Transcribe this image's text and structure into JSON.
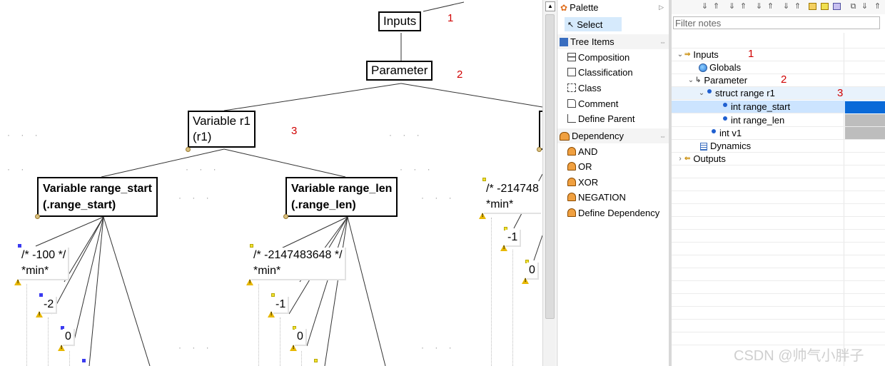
{
  "canvas": {
    "nodes": {
      "inputs": "Inputs",
      "parameter": "Parameter",
      "variable_r1_line1": "Variable r1",
      "variable_r1_line2": "(r1)",
      "range_start_line1": "Variable range_start",
      "range_start_line2": "(.range_start)",
      "range_len_line1": "Variable range_len",
      "range_len_line2": "(.range_len)"
    },
    "annotations": {
      "n1": "1",
      "n2": "2",
      "n3": "3"
    },
    "values": {
      "start_min_line1": "/* -100 */",
      "start_min_line2": "*min*",
      "start_v1": "-2",
      "start_v2": "0",
      "len_min_line1": "/* -2147483648 */",
      "len_min_line2": "*min*",
      "len_v1": "-1",
      "len_v2": "0",
      "v1_min_line1": "/* -214748",
      "v1_min_line2": "*min*",
      "v1_v1": "-1",
      "v1_v2": "0"
    }
  },
  "palette": {
    "title": "Palette",
    "select": "Select",
    "tree_items": {
      "header": "Tree Items",
      "items": [
        "Composition",
        "Classification",
        "Class",
        "Comment",
        "Define Parent"
      ]
    },
    "dependency": {
      "header": "Dependency",
      "items": [
        "AND",
        "OR",
        "XOR",
        "NEGATION",
        "Define Dependency"
      ]
    }
  },
  "notes": {
    "filter_placeholder": "Filter notes",
    "tree": {
      "inputs": "Inputs",
      "globals": "Globals",
      "parameter": "Parameter",
      "struct": "struct range r1",
      "range_start": "int range_start",
      "range_len": "int range_len",
      "v1": "int v1",
      "dynamics": "Dynamics",
      "outputs": "Outputs"
    },
    "annotations": {
      "n1": "1",
      "n2": "2",
      "n3": "3"
    },
    "colors": {
      "selected_cell": "#0a6ad8",
      "gray_cell": "#bdbdbd",
      "annotation_red": "#d00000"
    }
  },
  "watermark": "CSDN @帅气小胖子"
}
